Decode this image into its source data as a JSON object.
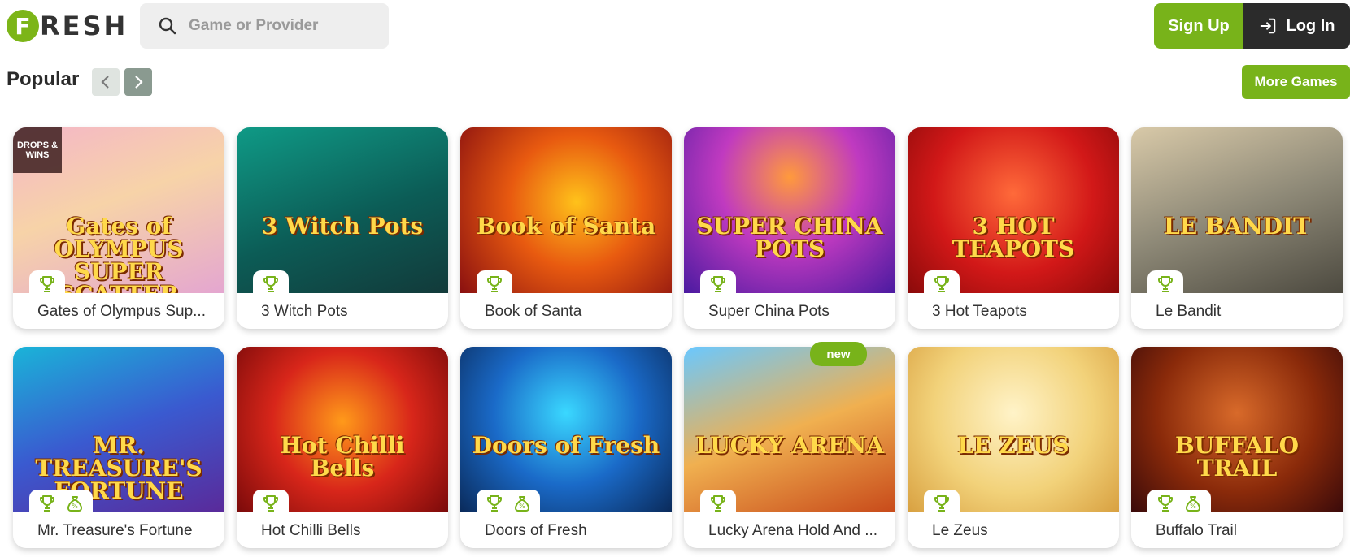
{
  "header": {
    "logo_letter": "F",
    "logo_text": "RESH",
    "search_placeholder": "Game or Provider",
    "signup_label": "Sign Up",
    "login_label": "Log In"
  },
  "section": {
    "title": "Popular",
    "more_games_label": "More Games"
  },
  "colors": {
    "brand_green": "#78b31a",
    "login_dark": "#2b2b2b"
  },
  "games": [
    {
      "name": "Gates of Olympus Sup...",
      "art_text": "Gates of OLYMPUS SUPER SCATTER",
      "bg": "linear-gradient(160deg,#f4b6c8 0%,#f7d3a8 45%,#e4a6d0 100%)",
      "badges": [
        "trophy-icon"
      ],
      "drops": "DROPS & WINS",
      "new": ""
    },
    {
      "name": "3 Witch Pots",
      "art_text": "3 Witch Pots",
      "bg": "linear-gradient(160deg,#0f9a86 0%,#0c5c56 55%,#123a3a 100%)",
      "badges": [
        "trophy-icon"
      ],
      "drops": "",
      "new": ""
    },
    {
      "name": "Book of Santa",
      "art_text": "Book of Santa",
      "bg": "radial-gradient(circle at 55% 45%,#ffc21a 0%,#e85a10 45%,#8a1010 100%)",
      "badges": [
        "trophy-icon"
      ],
      "drops": "",
      "new": ""
    },
    {
      "name": "Super China Pots",
      "art_text": "SUPER CHINA POTS",
      "bg": "radial-gradient(circle at 50% 30%,#ff9a3c 0%,#c03ac0 45%,#4a1aa0 100%)",
      "badges": [
        "trophy-icon"
      ],
      "drops": "",
      "new": ""
    },
    {
      "name": "3 Hot Teapots",
      "art_text": "3 HOT TEAPOTS",
      "bg": "radial-gradient(circle at 50% 40%,#ff6a3a 0%,#d21818 55%,#8a0a0a 100%)",
      "badges": [
        "trophy-icon"
      ],
      "drops": "",
      "new": ""
    },
    {
      "name": "Le Bandit",
      "art_text": "LE BANDIT",
      "bg": "linear-gradient(160deg,#d8c9a8 0%,#8f8a78 50%,#4d4a40 100%)",
      "badges": [
        "trophy-icon"
      ],
      "drops": "",
      "new": ""
    },
    {
      "name": "Mr. Treasure's Fortune",
      "art_text": "MR. TREASURE'S FORTUNE",
      "bg": "linear-gradient(160deg,#1ab4d8 0%,#3a5ad0 50%,#5a2a9a 100%)",
      "badges": [
        "trophy-icon",
        "money-bag-icon"
      ],
      "drops": "",
      "new": ""
    },
    {
      "name": "Hot Chilli Bells",
      "art_text": "Hot Chilli Bells",
      "bg": "radial-gradient(circle at 50% 45%,#ff9a1a 0%,#d8261a 50%,#7a0a0a 100%)",
      "badges": [
        "trophy-icon"
      ],
      "drops": "",
      "new": ""
    },
    {
      "name": "Doors of Fresh",
      "art_text": "Doors of Fresh",
      "bg": "radial-gradient(circle at 50% 40%,#3ad8ff 0%,#1a6ac8 50%,#0a2a5a 100%)",
      "badges": [
        "trophy-icon",
        "money-bag-icon"
      ],
      "drops": "",
      "new": ""
    },
    {
      "name": "Lucky Arena Hold And ...",
      "art_text": "LUCKY ARENA",
      "bg": "linear-gradient(160deg,#6ac8ff 0%,#f0b050 50%,#c84a1a 100%)",
      "badges": [
        "trophy-icon"
      ],
      "drops": "",
      "new": "new"
    },
    {
      "name": "Le Zeus",
      "art_text": "LE ZEUS",
      "bg": "radial-gradient(circle at 50% 40%,#fff3c8 0%,#f2d27a 55%,#d8a040 100%)",
      "badges": [
        "trophy-icon"
      ],
      "drops": "",
      "new": ""
    },
    {
      "name": "Buffalo Trail",
      "art_text": "BUFFALO TRAIL",
      "bg": "radial-gradient(circle at 50% 40%,#d86a2a 0%,#8a2a0a 55%,#3a0a0a 100%)",
      "badges": [
        "trophy-icon",
        "money-bag-icon"
      ],
      "drops": "",
      "new": ""
    }
  ]
}
